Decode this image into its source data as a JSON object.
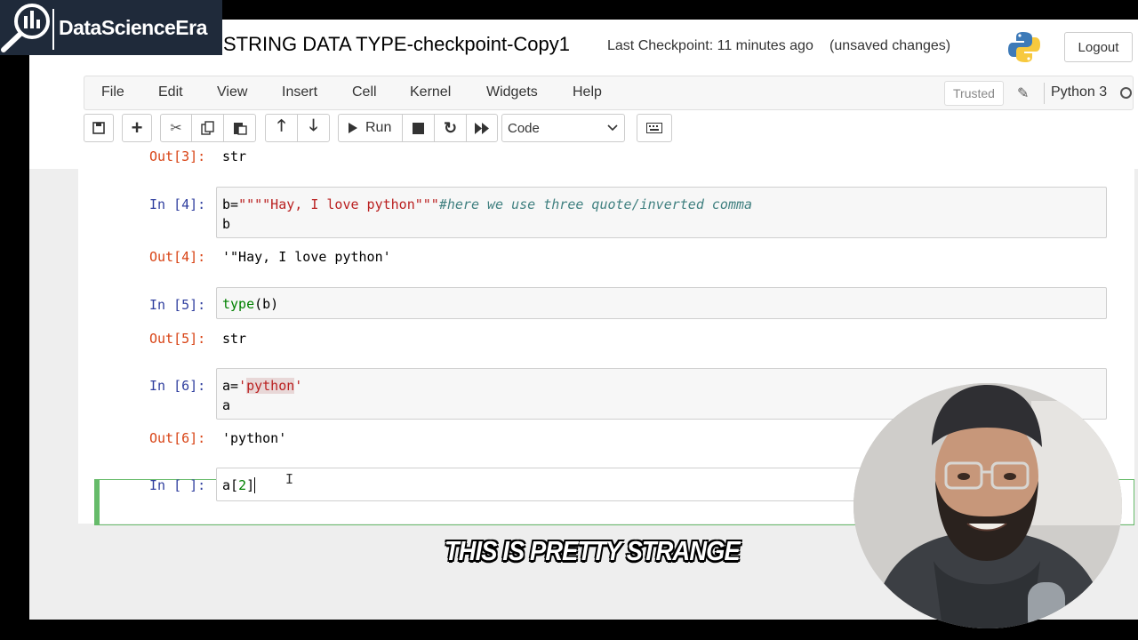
{
  "brand": {
    "name": "DataScienceEra"
  },
  "header": {
    "notebook_title": "STRING DATA TYPE-checkpoint-Copy1",
    "checkpoint": "Last Checkpoint: 11 minutes ago",
    "status": "(unsaved changes)",
    "logout_label": "Logout"
  },
  "menu": {
    "items": [
      "File",
      "Edit",
      "View",
      "Insert",
      "Cell",
      "Kernel",
      "Widgets",
      "Help"
    ],
    "trusted_label": "Trusted",
    "kernel_name": "Python 3"
  },
  "toolbar": {
    "run_label": "Run",
    "cell_type": "Code",
    "icons": [
      "save-icon",
      "add-cell-icon",
      "cut-icon",
      "copy-icon",
      "paste-icon",
      "move-up-icon",
      "move-down-icon",
      "run-icon",
      "stop-icon",
      "restart-icon",
      "fast-forward-icon",
      "keyboard-icon"
    ]
  },
  "cells": {
    "out3_prompt": "Out[3]:",
    "out3_text": "str",
    "in4_prompt": "In [4]:",
    "in4_code_var": "b=",
    "in4_code_str": "\"\"\"\"Hay, I love python\"\"\"",
    "in4_code_comment": "#here we use three quote/inverted comma",
    "in4_code_line2": "b",
    "out4_prompt": "Out[4]:",
    "out4_text": "'\"Hay, I love python'",
    "in5_prompt": "In [5]:",
    "in5_code_fn": "type",
    "in5_code_args": "(b)",
    "out5_prompt": "Out[5]:",
    "out5_text": "str",
    "in6_prompt": "In [6]:",
    "in6_code_var": "a=",
    "in6_code_q1": "'",
    "in6_code_str": "python",
    "in6_code_q2": "'",
    "in6_code_line2": "a",
    "out6_prompt": "Out[6]:",
    "out6_text": "'python'",
    "in7_prompt": "In [ ]:",
    "in7_code_var": "a[",
    "in7_code_num": "2",
    "in7_code_end": "]"
  },
  "caption": {
    "text": "THIS IS PRETTY STRANGE"
  },
  "colors": {
    "in_prompt": "#303f9f",
    "out_prompt": "#d84315",
    "active_cell": "#66bb6a"
  }
}
